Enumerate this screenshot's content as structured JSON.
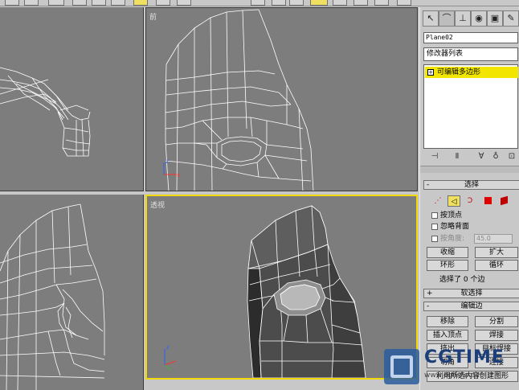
{
  "viewports": {
    "front_label": "前",
    "persp_label": "透视"
  },
  "panel": {
    "tabs": [
      "create-icon",
      "modify-icon",
      "hierarchy-icon",
      "motion-icon",
      "display-icon",
      "utilities-icon"
    ],
    "object_name": "Plane02",
    "modifier_list": "修改器列表",
    "stack_item": "可编辑多边形",
    "stack_item_toggle": "+",
    "stack_tool_glyphs": [
      "⊣",
      "Ⅱ",
      "∀",
      "♁",
      "⊡"
    ]
  },
  "selection_rollout": {
    "sign": "-",
    "title": "选择",
    "modes": [
      "vertex",
      "edge",
      "border",
      "polygon",
      "element"
    ],
    "by_vertex": "按顶点",
    "ignore_backfacing": "忽略背面",
    "by_angle": "按角度:",
    "angle_value": "45.0",
    "shrink": "收缩",
    "grow": "扩大",
    "ring": "环形",
    "loop": "循环",
    "status": "选择了 0 个边"
  },
  "soft_selection_rollout": {
    "sign": "+",
    "title": "软选择"
  },
  "edit_edges_rollout": {
    "sign": "-",
    "title": "编辑边",
    "remove": "移除",
    "split": "分割",
    "insert_vertex": "插入顶点",
    "weld": "焊接",
    "extrude": "挤出",
    "target_weld": "目标焊接",
    "chamfer": "切角",
    "connect": "连接",
    "create_shape": "利用所选内容创建图形"
  },
  "watermark": {
    "brand": "CGTIME",
    "sub": "www.cgtime.net"
  },
  "colors": {
    "viewport_bg": "#7d7d7d",
    "active_border": "#f0d800",
    "stack_highlight": "#f2e600",
    "wire": "#ffffff"
  }
}
